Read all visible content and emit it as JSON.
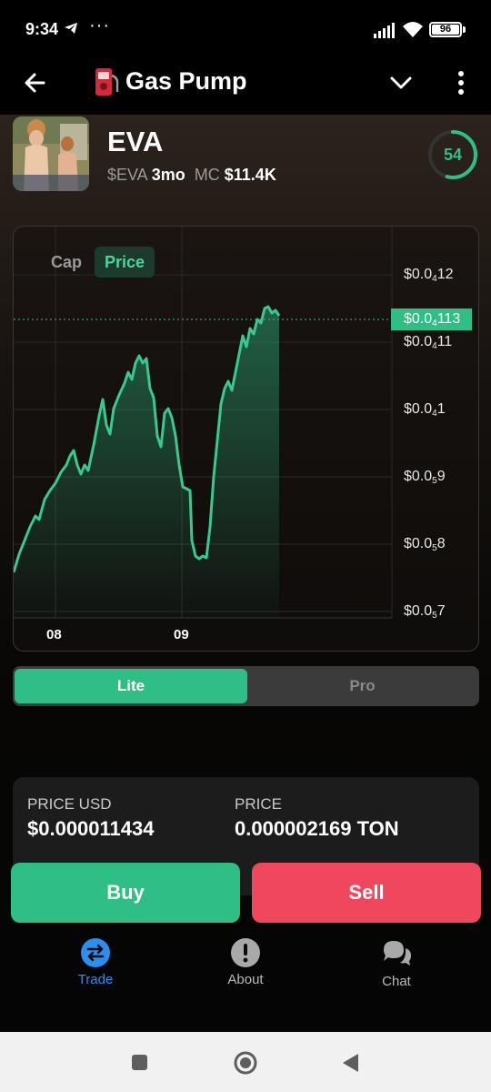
{
  "status_bar": {
    "time": "9:34",
    "dots": "···",
    "battery": "96"
  },
  "header": {
    "title": "Gas Pump"
  },
  "token": {
    "name": "EVA",
    "ticker": "$EVA",
    "age": "3mo",
    "mc_label": "MC",
    "mc_value": "$11.4K",
    "score": "54",
    "score_fraction": 0.54
  },
  "chart": {
    "toggle_cap": "Cap",
    "toggle_price": "Price",
    "current_tag": {
      "base": "$0.0",
      "sub": "4",
      "rest": "113"
    },
    "y_labels": [
      {
        "base": "$0.0",
        "sub": "4",
        "rest": "12"
      },
      {
        "base": "$0.0",
        "sub": "4",
        "rest": "11"
      },
      {
        "base": "$0.0",
        "sub": "4",
        "rest": "1"
      },
      {
        "base": "$0.0",
        "sub": "5",
        "rest": "9"
      },
      {
        "base": "$0.0",
        "sub": "5",
        "rest": "8"
      },
      {
        "base": "$0.0",
        "sub": "5",
        "rest": "7"
      }
    ],
    "x_labels": [
      "08",
      "09"
    ],
    "accent": "#2fbf85"
  },
  "mode": {
    "lite": "Lite",
    "pro": "Pro"
  },
  "prices": {
    "usd_label": "PRICE USD",
    "usd_value": "$0.000011434",
    "ton_label": "PRICE",
    "ton_value": "0.000002169 TON"
  },
  "actions": {
    "buy": "Buy",
    "sell": "Sell",
    "buy_color": "#2fbf85",
    "sell_color": "#f0475f"
  },
  "tabs": [
    {
      "label": "Trade",
      "icon": "swap-icon",
      "active": true
    },
    {
      "label": "About",
      "icon": "info-icon",
      "active": false
    },
    {
      "label": "Chat",
      "icon": "chat-bubbles-icon",
      "active": false
    }
  ]
}
